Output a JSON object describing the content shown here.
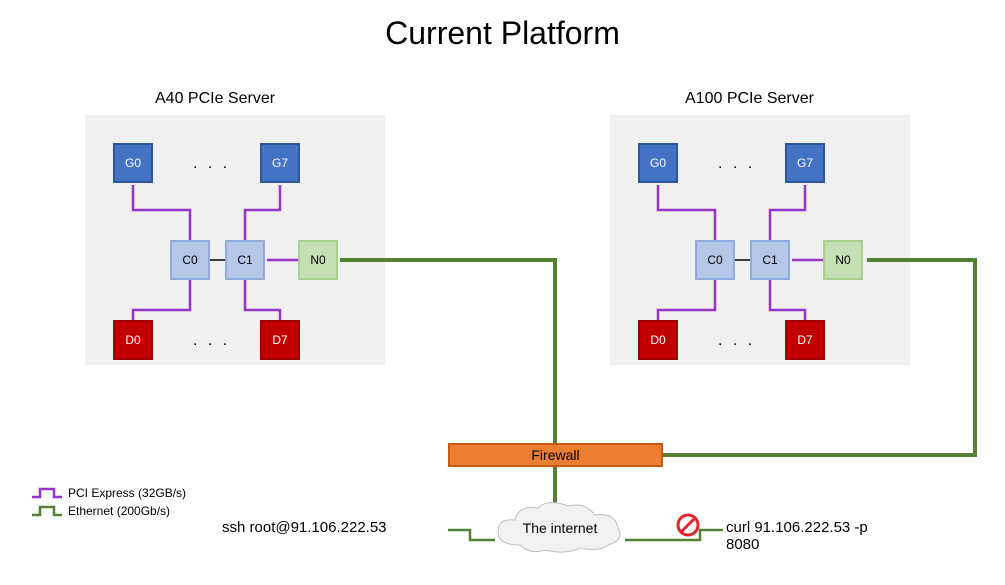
{
  "title": "Current Platform",
  "servers": {
    "left": {
      "label": "A40 PCIe Server"
    },
    "right": {
      "label": "A100 PCIe Server"
    }
  },
  "nodes": {
    "g0": "G0",
    "g7": "G7",
    "c0": "C0",
    "c1": "C1",
    "n0": "N0",
    "d0": "D0",
    "d7": "D7"
  },
  "ellipsis": ". . .",
  "firewall": "Firewall",
  "internet": "The internet",
  "legend": {
    "pci": "PCI Express (32GB/s)",
    "eth": "Ethernet (200Gb/s)"
  },
  "commands": {
    "ssh": "ssh root@91.106.222.53",
    "curl": "curl 91.106.222.53 -p 8080"
  }
}
